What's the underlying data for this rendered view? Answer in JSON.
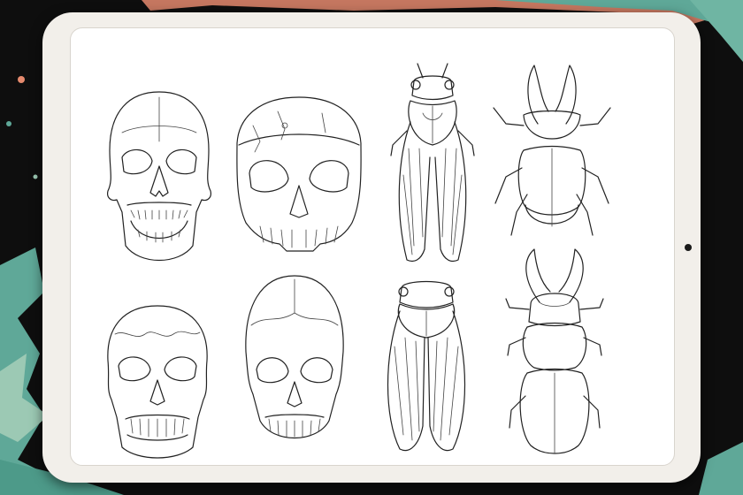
{
  "colors": {
    "background": "#0e0e0e",
    "accent_teal": "#5fa898",
    "accent_coral": "#e58a6e",
    "device_frame": "#f2efea",
    "screen": "#ffffff",
    "line_art": "#222222"
  },
  "device": {
    "type": "tablet",
    "camera": "front-camera-dot"
  },
  "canvas": {
    "illustrations": [
      {
        "name": "human-skull-open-jaw"
      },
      {
        "name": "cracked-skull-front"
      },
      {
        "name": "cicada-top-view"
      },
      {
        "name": "rhinoceros-beetle"
      },
      {
        "name": "human-skull-sutures"
      },
      {
        "name": "elongated-skull"
      },
      {
        "name": "cicada-wings-closed"
      },
      {
        "name": "stag-beetle"
      }
    ]
  }
}
